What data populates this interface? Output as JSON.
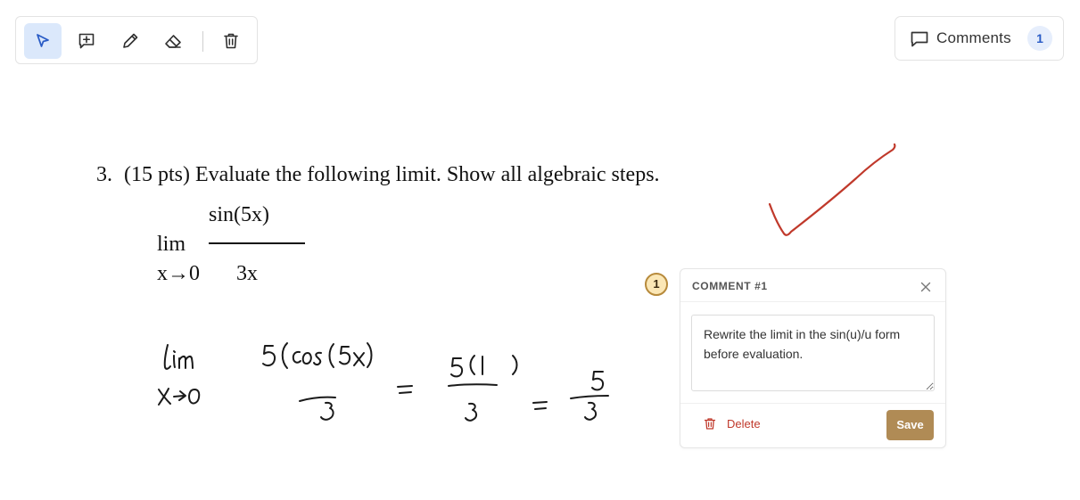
{
  "toolbar": {
    "tools": [
      {
        "name": "select",
        "icon": "cursor-arrow-icon",
        "active": true
      },
      {
        "name": "add-comment",
        "icon": "comment-plus-icon",
        "active": false
      },
      {
        "name": "pen",
        "icon": "pencil-icon",
        "active": false
      },
      {
        "name": "eraser",
        "icon": "eraser-icon",
        "active": false
      },
      {
        "name": "delete",
        "icon": "trash-icon",
        "active": false
      }
    ],
    "active_color": "#dbe8fb",
    "icon_color": "#2f2f2f",
    "active_icon_color": "#2a5cc6"
  },
  "comments_button": {
    "label": "Comments",
    "count": "1",
    "icon": "speech-bubble-icon"
  },
  "document": {
    "question_number": "3.",
    "question_text": "(15 pts) Evaluate the following limit. Show all algebraic steps.",
    "limit_numerator": "sin(5x)",
    "limit_word": "lim",
    "limit_subscript": "x→0",
    "limit_denominator": "3x"
  },
  "ink": {
    "check_color": "#c0392b",
    "handwriting_color": "#1a1a1a"
  },
  "comment_pin": {
    "number": "1"
  },
  "comment_card": {
    "title": "COMMENT #1",
    "text": "Rewrite the limit in the sin(u)/u form before evaluation.",
    "delete_label": "Delete",
    "save_label": "Save",
    "delete_color": "#c0392b",
    "save_color": "#b08b55"
  }
}
